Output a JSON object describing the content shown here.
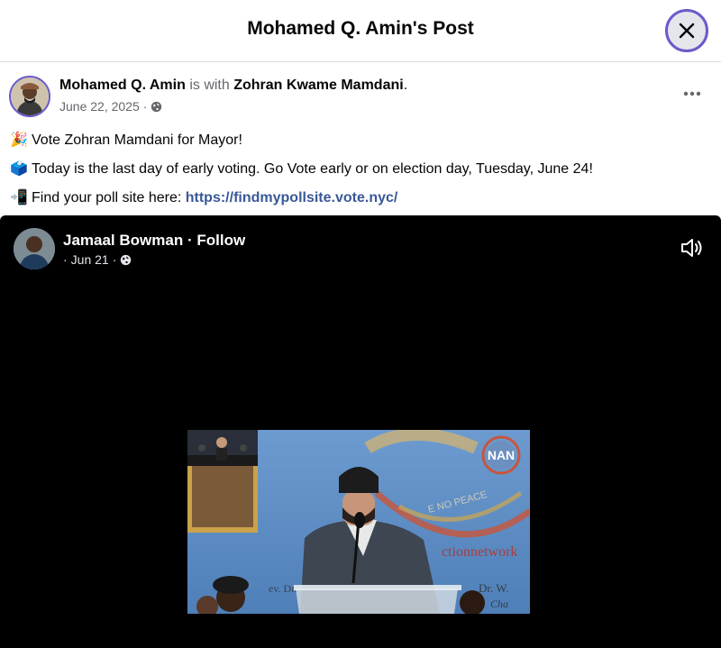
{
  "header": {
    "title": "Mohamed Q. Amin's Post"
  },
  "close_icon": "close-icon",
  "post": {
    "author": "Mohamed Q. Amin",
    "with_text": "is with",
    "tagged": "Zohran Kwame Mamdani",
    "period": ".",
    "date": "June 22, 2025",
    "separator": "·",
    "lines": [
      {
        "emoji": "🎉",
        "text": "Vote Zohran Mamdani for Mayor!"
      },
      {
        "emoji": "🗳️",
        "text": "Today is the last day of early voting. Go Vote early or on election day, Tuesday, June 24!"
      },
      {
        "emoji": "📲",
        "text": "Find your poll site here: ",
        "link": "https://findmypollsite.vote.nyc/"
      }
    ]
  },
  "shared_video": {
    "author": "Jamaal Bowman",
    "follow": "Follow",
    "dot": "·",
    "date": "Jun 21",
    "overlay_logo": "NAN"
  },
  "colors": {
    "focus_ring": "#6a5acd",
    "link": "#385898",
    "muted": "#65676b",
    "video_bg": "#000000"
  }
}
